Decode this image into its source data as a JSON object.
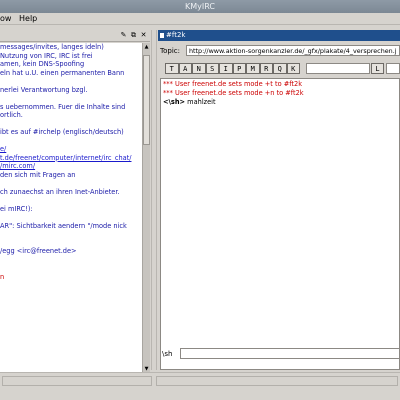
{
  "window": {
    "title": "KMyIRC"
  },
  "menu": {
    "items": [
      {
        "label": "ow"
      },
      {
        "label": "Help"
      }
    ]
  },
  "left_pane": {
    "header_buttons": [
      "✎",
      "⧉",
      "✕"
    ],
    "lines": [
      {
        "text": "messages/invites, langes ideln)",
        "style": "normal"
      },
      {
        "text": "Nutzung von IRC, IRC ist frei",
        "style": "normal"
      },
      {
        "text": "amen, kein DNS-Spoofing",
        "style": "normal"
      },
      {
        "text": "eln hat u.U. einen permanenten Bann",
        "style": "normal"
      },
      {
        "text": "",
        "style": "normal"
      },
      {
        "text": "nerlei Verantwortung bzgl.",
        "style": "normal"
      },
      {
        "text": "",
        "style": "normal"
      },
      {
        "text": "s uebernommen. Fuer die Inhalte sind",
        "style": "normal"
      },
      {
        "text": "ortlich.",
        "style": "normal"
      },
      {
        "text": "",
        "style": "normal"
      },
      {
        "text": "ibt es auf #irchelp (englisch/deutsch)",
        "style": "normal"
      },
      {
        "text": "",
        "style": "normal"
      },
      {
        "text": "e/",
        "style": "link"
      },
      {
        "text": "t.de/freenet/computer/internet/irc_chat/",
        "style": "link"
      },
      {
        "text": "/mirc.com/",
        "style": "link"
      },
      {
        "text": "den sich mit Fragen an",
        "style": "normal"
      },
      {
        "text": "",
        "style": "normal"
      },
      {
        "text": "ch zunaechst an ihren Inet-Anbieter.",
        "style": "normal"
      },
      {
        "text": "",
        "style": "normal"
      },
      {
        "text": "ei mIRC!):",
        "style": "normal"
      },
      {
        "text": "",
        "style": "normal"
      },
      {
        "text": "AR\": Sichtbarkeit aendern \"/mode nick",
        "style": "normal"
      },
      {
        "text": "",
        "style": "normal"
      },
      {
        "text": "",
        "style": "normal"
      },
      {
        "text": "/egg <irc@freenet.de>",
        "style": "normal"
      },
      {
        "text": "",
        "style": "normal"
      },
      {
        "text": "",
        "style": "normal"
      },
      {
        "text": "n",
        "style": "red"
      }
    ],
    "input_value": ""
  },
  "right_pane": {
    "channel_tab": "#ft2k",
    "topic_label": "Topic:",
    "topic_value": "http://www.aktion-sorgenkanzler.de/_gfx/plakate/4_versprechen.j",
    "mode_buttons": [
      "T",
      "A",
      "N",
      "S",
      "I",
      "P",
      "M",
      "R",
      "Q",
      "K"
    ],
    "limit_button": "L",
    "limit_value": "",
    "key_value": "",
    "messages": [
      {
        "prefix": "***",
        "text": " User freenet.de sets mode +t to #ft2k",
        "kind": "sys"
      },
      {
        "prefix": "***",
        "text": " User freenet.de sets mode +n to #ft2k",
        "kind": "sys"
      },
      {
        "prefix": "<\\sh>",
        "text": " mahlzeit",
        "kind": "msg"
      }
    ],
    "nick": "\\sh",
    "input_value": ""
  },
  "colors": {
    "tab_bg": "#1f4f8c",
    "system_msg": "#cc0000",
    "left_text": "#1a1aa8"
  }
}
